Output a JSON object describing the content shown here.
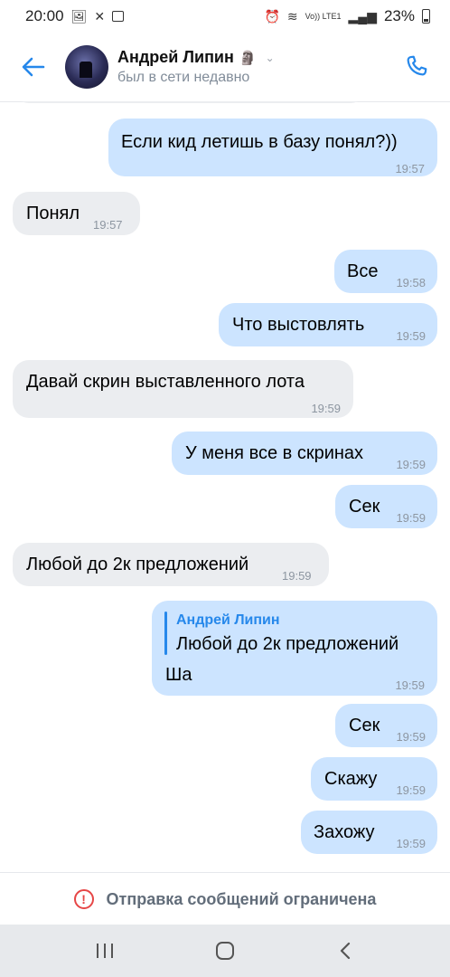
{
  "status_bar": {
    "time": "20:00",
    "network": "Vo)) LTE1",
    "battery_percent": "23%"
  },
  "header": {
    "contact_name": "Андрей Липин",
    "contact_emoji": "🗿",
    "status": "был в сети недавно"
  },
  "messages": [
    {
      "dir": "out",
      "text": "Если кид летишь в базу понял?))",
      "time": "19:57"
    },
    {
      "dir": "in",
      "text": "Понял",
      "time": "19:57"
    },
    {
      "dir": "out",
      "text": "Все",
      "time": "19:58"
    },
    {
      "dir": "out",
      "text": "Что выстовлять",
      "time": "19:59"
    },
    {
      "dir": "in",
      "text": "Давай скрин выставленного лота",
      "time": "19:59"
    },
    {
      "dir": "out",
      "text": "У меня все в скринах",
      "time": "19:59"
    },
    {
      "dir": "out",
      "text": "Сек",
      "time": "19:59"
    },
    {
      "dir": "in",
      "text": "Любой до 2к предложений",
      "time": "19:59"
    },
    {
      "dir": "out",
      "reply_author": "Андрей Липин",
      "reply_text": "Любой до 2к предложений",
      "text": "Ша",
      "time": "19:59"
    },
    {
      "dir": "out",
      "text": "Сек",
      "time": "19:59"
    },
    {
      "dir": "out",
      "text": "Скажу",
      "time": "19:59"
    },
    {
      "dir": "out",
      "text": "Захожу",
      "time": "19:59"
    }
  ],
  "footer": {
    "restriction_text": "Отправка сообщений ограничена"
  },
  "colors": {
    "accent": "#2688eb",
    "incoming_bubble": "#ebedf0",
    "outgoing_bubble": "#cce4ff",
    "warning": "#e64646"
  }
}
